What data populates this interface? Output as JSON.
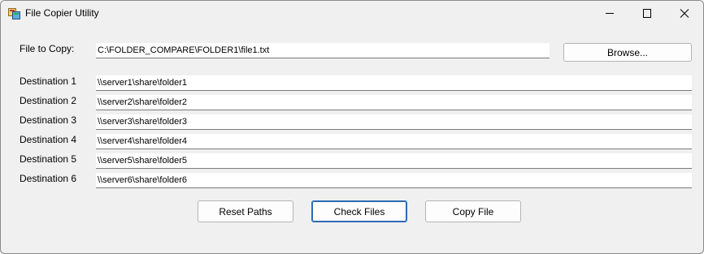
{
  "window": {
    "title": "File Copier Utility",
    "icon": "app-icon",
    "controls": {
      "minimize_icon": "minimize-icon",
      "maximize_icon": "maximize-icon",
      "close_icon": "close-icon"
    }
  },
  "source": {
    "label": "File to Copy:",
    "value": "C:\\FOLDER_COMPARE\\FOLDER1\\file1.txt",
    "browse_label": "Browse..."
  },
  "destinations": [
    {
      "label": "Destination 1",
      "value": "\\\\server1\\share\\folder1"
    },
    {
      "label": "Destination 2",
      "value": "\\\\server2\\share\\folder2"
    },
    {
      "label": "Destination 3",
      "value": "\\\\server3\\share\\folder3"
    },
    {
      "label": "Destination 4",
      "value": "\\\\server4\\share\\folder4"
    },
    {
      "label": "Destination 5",
      "value": "\\\\server5\\share\\folder5"
    },
    {
      "label": "Destination 6",
      "value": "\\\\server6\\share\\folder6"
    }
  ],
  "actions": {
    "reset_label": "Reset Paths",
    "check_label": "Check Files",
    "copy_label": "Copy File"
  },
  "colors": {
    "window_bg": "#f0f0f0",
    "focus_border": "#2d6ab4"
  }
}
